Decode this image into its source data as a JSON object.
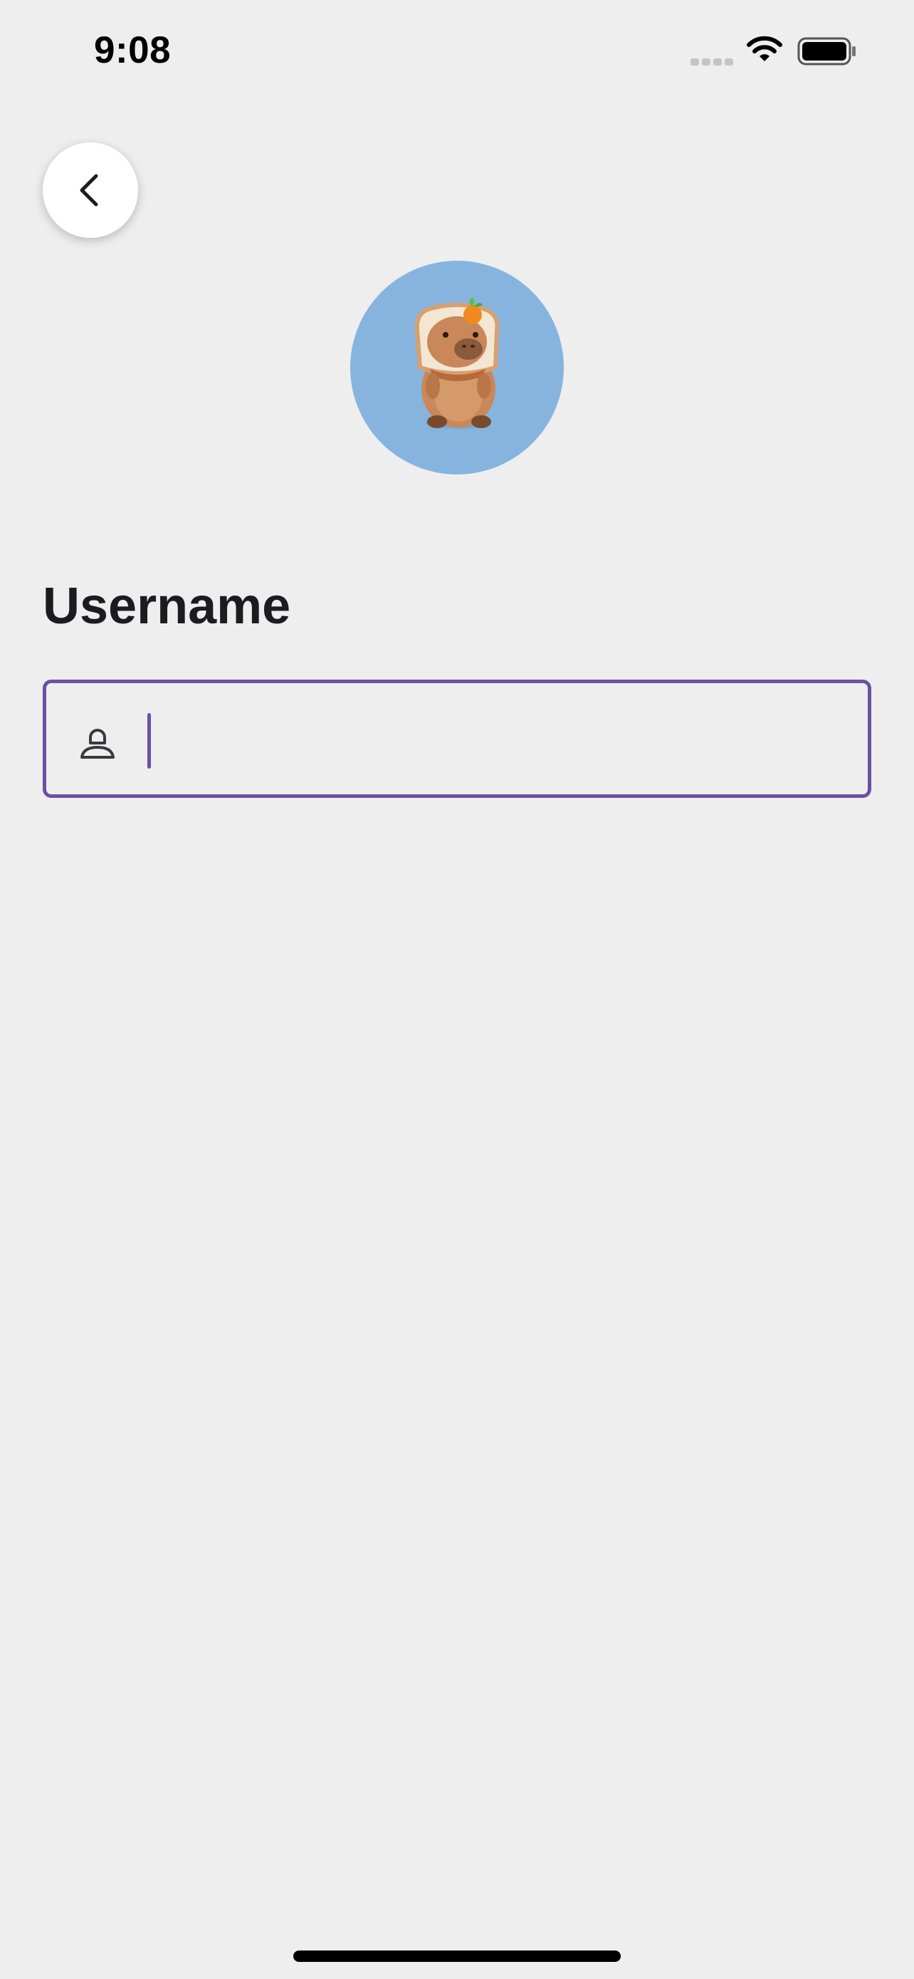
{
  "status_bar": {
    "time": "9:08"
  },
  "icons": {
    "back": "chevron-left-icon",
    "field": "person-icon",
    "signal": "cellular-signal-icon",
    "wifi": "wifi-icon",
    "battery": "battery-icon"
  },
  "avatar": {
    "background_color": "#87b4df",
    "subject": "capybara-plush-avatar"
  },
  "form": {
    "username_label": "Username",
    "username_value": "",
    "username_placeholder": "",
    "focus_color": "#6a51a3"
  }
}
